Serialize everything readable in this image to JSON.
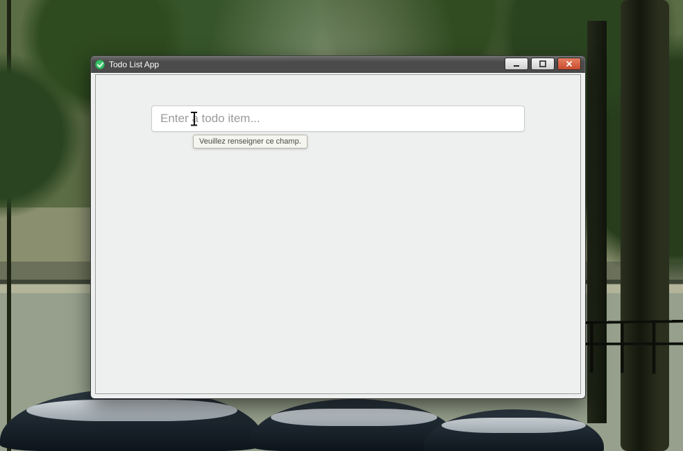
{
  "window": {
    "title": "Todo List App",
    "icon": "check-icon"
  },
  "controls": {
    "minimize": "minimize",
    "maximize": "maximize",
    "close": "close"
  },
  "todo": {
    "input_value": "",
    "input_placeholder": "Enter a todo item..."
  },
  "validation": {
    "message": "Veuillez renseigner ce champ."
  }
}
